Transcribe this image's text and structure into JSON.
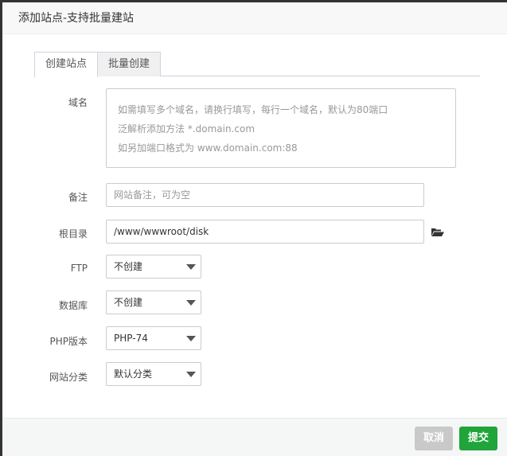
{
  "title": "添加站点-支持批量建站",
  "tabs": [
    "创建站点",
    "批量创建"
  ],
  "domain": {
    "label": "域名",
    "placeholder_lines": [
      "如需填写多个域名，请换行填写，每行一个域名，默认为80端口",
      "泛解析添加方法 *.domain.com",
      "如另加端口格式为 www.domain.com:88"
    ]
  },
  "remark": {
    "label": "备注",
    "placeholder": "网站备注，可为空"
  },
  "root": {
    "label": "根目录",
    "value": "/www/wwwroot/disk"
  },
  "ftp": {
    "label": "FTP",
    "value": "不创建"
  },
  "database": {
    "label": "数据库",
    "value": "不创建"
  },
  "php": {
    "label": "PHP版本",
    "value": "PHP-74"
  },
  "category": {
    "label": "网站分类",
    "value": "默认分类"
  },
  "buttons": {
    "cancel": "取消",
    "submit": "提交"
  },
  "colors": {
    "submit": "#20a53a",
    "cancel": "#c9c9c9"
  }
}
